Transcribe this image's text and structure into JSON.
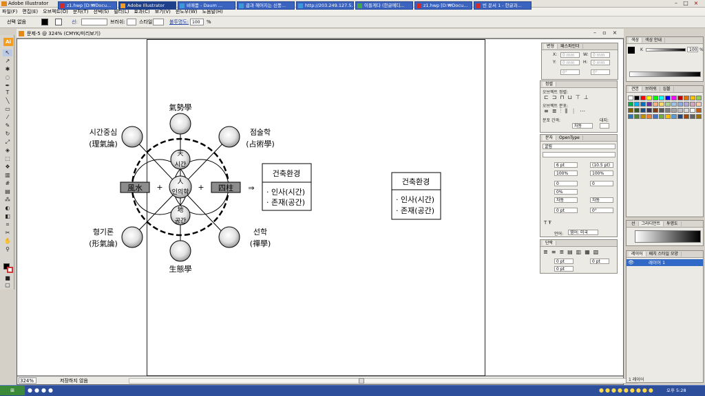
{
  "window": {
    "title": "Adobe Illustrator"
  },
  "menu": [
    "파일(F)",
    "편집(E)",
    "오브젝트(O)",
    "문자(T)",
    "선택(S)",
    "필터(L)",
    "효과(C)",
    "보기(V)",
    "윈도우(W)",
    "도움말(H)"
  ],
  "control_bar": {
    "selection_label": "선택 없음",
    "stroke_label": "선:",
    "brush_label": "브러쉬:",
    "style_label": "스타일:",
    "opacity_label": "불투명도:",
    "opacity_value": "100",
    "percent": "%"
  },
  "document": {
    "tab_title": "문제-5 @ 324% (CMYK/미리보기)",
    "zoom": "324%",
    "status": "저장하지 않음"
  },
  "diagram": {
    "top_label": "氣勢學",
    "left_top_label": "시간중심",
    "left_top_sub": "(理氣論)",
    "right_top_label": "점술학",
    "right_top_sub": "(占術學)",
    "left_bottom_label": "형기론",
    "left_bottom_sub": "(形氣論)",
    "right_bottom_label": "선학",
    "right_bottom_sub": "(禪學)",
    "bottom_label": "生態學",
    "left_box": "風水",
    "right_box": "四柱",
    "center_top": "天",
    "center_top_sub": "시간",
    "center_mid": "人",
    "center_mid_sub": "인의학",
    "center_bot": "地",
    "center_bot_sub": "공간",
    "arrow": "⇒",
    "box1_title": "건축환경",
    "box1_line1": "· 인사(시간)",
    "box1_line2": "· 존재(공간)",
    "box2_title": "건축환경",
    "box2_line1": "· 인사(시간)",
    "box2_line2": "· 존재(공간)"
  },
  "panels": {
    "transform": {
      "tabs": [
        "변형",
        "패스파인더"
      ],
      "x": "X:",
      "y": "Y:",
      "w": "W:",
      "h": "H:",
      "xv": "0 mm",
      "yv": "0 mm",
      "wv": "0 mm",
      "hv": "0 mm",
      "angle": "0°",
      "shear": "0°"
    },
    "align": {
      "tab": "정렬",
      "obj_align": "오브젝트 정렬:",
      "obj_dist": "오브젝트 분포:",
      "dist_space": "분포 간격:",
      "align_to": "대지:",
      "auto": "자동"
    },
    "character": {
      "tabs": [
        "문자",
        "OpenType"
      ],
      "font": "굴림",
      "size": "6 pt",
      "leading": "(10.5 pt)",
      "hscale": "100%",
      "vscale": "100%",
      "kern": "0",
      "track": "0",
      "baseline": "0%",
      "auto1": "자동",
      "auto2": "자동",
      "baseline_pt": "0 pt",
      "rotate": "0°",
      "language_label": "언어:",
      "language": "영어: 미국"
    },
    "paragraph": {
      "tab": "단락",
      "left": "0 pt",
      "right": "0 pt",
      "first": "0 pt"
    },
    "color": {
      "tabs": [
        "색상",
        "색상 안내"
      ],
      "k_label": "K",
      "k_value": "100",
      "percent": "%"
    },
    "swatches": {
      "tabs": [
        "견본",
        "브러쉬",
        "심볼"
      ]
    },
    "stroke": {
      "tabs": [
        "선",
        "그라디언트",
        "투명도"
      ]
    },
    "layers": {
      "tabs": [
        "레이어",
        "패치 스타일 모양"
      ],
      "layer_name": "레이어 1",
      "count": "1 레이어"
    }
  },
  "taskbar": {
    "tasks": [
      "z1.hwp [D:₩Docu...",
      "Adobe Illustrator",
      "비매품 - Daum ...",
      "곱과 헤어지는 신풍...",
      "http://203.249.127.5...",
      "이들게다 (한글에디...",
      "z1.hwp [D:₩Docu...",
      "빈 문서 1 - 한글과..."
    ],
    "clock": "오후 5:28"
  },
  "colors": {
    "accent": "#f39c1f",
    "taskbar": "#2d4e9a",
    "selected_layer": "#3169c6"
  }
}
